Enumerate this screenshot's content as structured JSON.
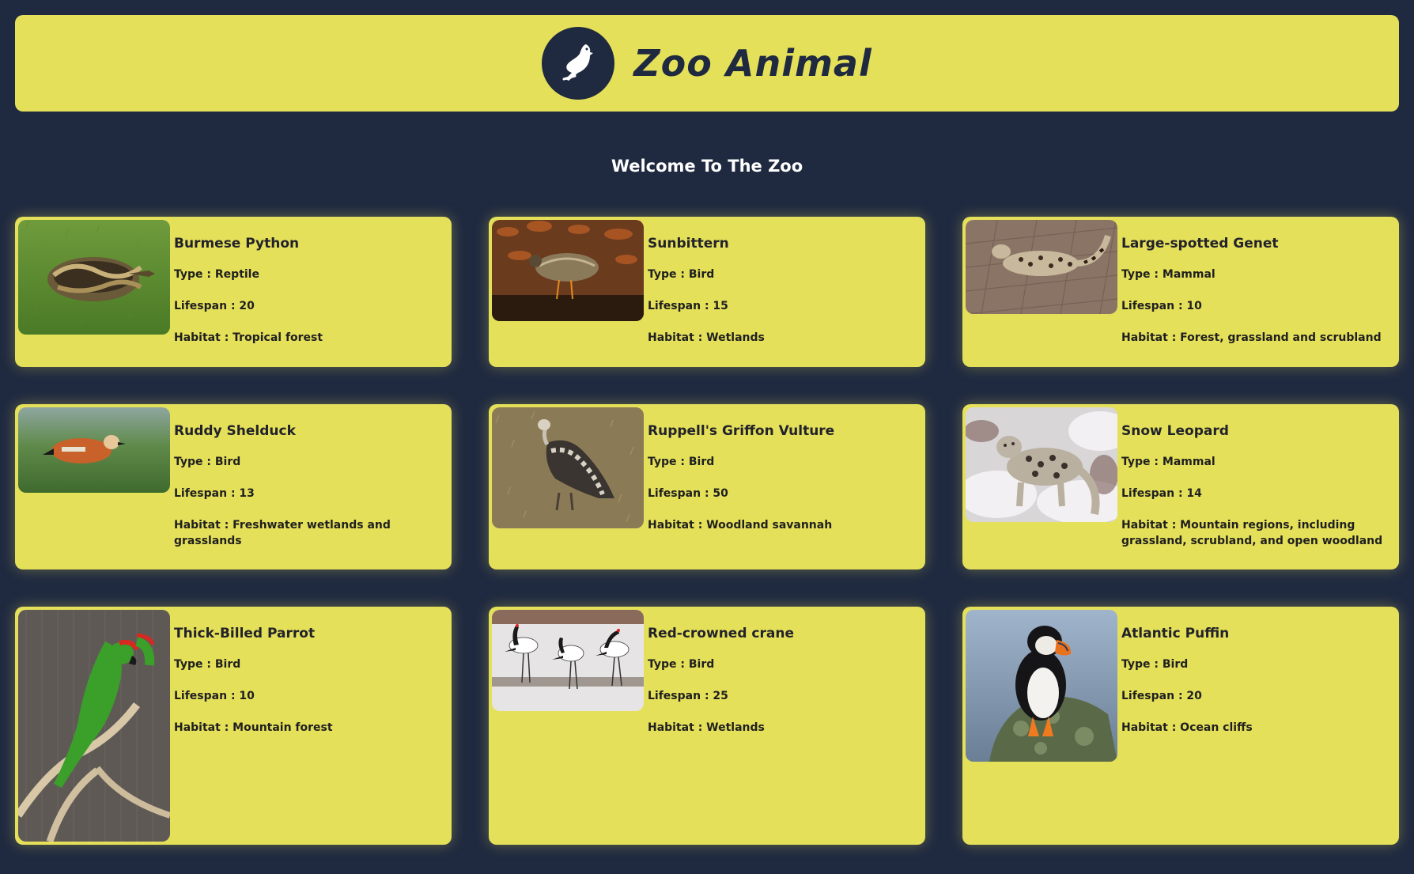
{
  "header": {
    "title": "Zoo Animal",
    "logo_icon": "bird-icon"
  },
  "welcome": "Welcome To The Zoo",
  "colors": {
    "background": "#1f2940",
    "card": "#e5e05a",
    "text_dark": "#1f1f1f"
  },
  "labels": {
    "type": "Type : ",
    "lifespan": "Lifespan : ",
    "habitat": "Habitat : "
  },
  "animals": [
    {
      "name": "Burmese Python",
      "type": "Reptile",
      "lifespan": "20",
      "habitat": "Tropical forest",
      "image": "python-photo"
    },
    {
      "name": "Sunbittern",
      "type": "Bird",
      "lifespan": "15",
      "habitat": "Wetlands",
      "image": "sunbittern-photo"
    },
    {
      "name": "Large-spotted Genet",
      "type": "Mammal",
      "lifespan": "10",
      "habitat": "Forest, grassland and scrubland",
      "image": "genet-photo"
    },
    {
      "name": "Ruddy Shelduck",
      "type": "Bird",
      "lifespan": "13",
      "habitat": "Freshwater wetlands and grasslands",
      "image": "shelduck-photo"
    },
    {
      "name": "Ruppell's Griffon Vulture",
      "type": "Bird",
      "lifespan": "50",
      "habitat": "Woodland savannah",
      "image": "vulture-photo"
    },
    {
      "name": "Snow Leopard",
      "type": "Mammal",
      "lifespan": "14",
      "habitat": "Mountain regions, including grassland, scrubland, and open woodland",
      "image": "leopard-photo"
    },
    {
      "name": "Thick-Billed Parrot",
      "type": "Bird",
      "lifespan": "10",
      "habitat": "Mountain forest",
      "image": "parrot-photo"
    },
    {
      "name": "Red-crowned crane",
      "type": "Bird",
      "lifespan": "25",
      "habitat": "Wetlands",
      "image": "crane-photo"
    },
    {
      "name": "Atlantic Puffin",
      "type": "Bird",
      "lifespan": "20",
      "habitat": "Ocean cliffs",
      "image": "puffin-photo"
    }
  ]
}
